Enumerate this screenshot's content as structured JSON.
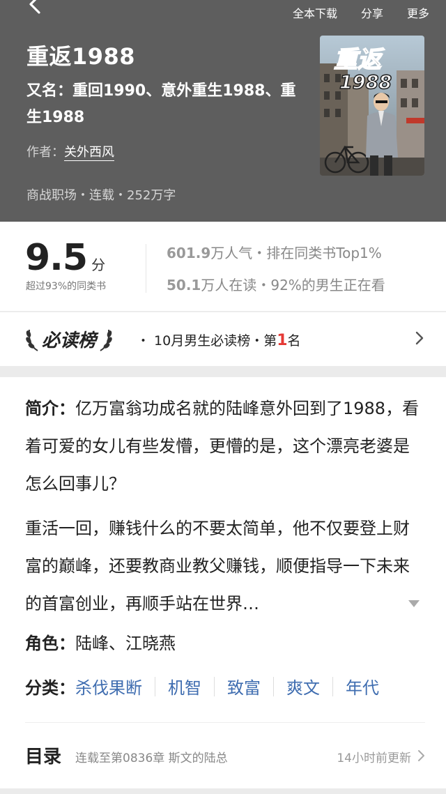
{
  "top_actions": {
    "download": "全本下载",
    "share": "分享",
    "more": "更多"
  },
  "book": {
    "title": "重返1988",
    "alias": "又名：重回1990、意外重生1988、重生1988",
    "author_label": "作者：",
    "author": "关外西风",
    "meta": "商战职场・连载・252万字",
    "cover_title": "重返",
    "cover_year": "1988"
  },
  "stats": {
    "score": "9.5",
    "score_unit": "分",
    "score_sub": "超过93%的同类书",
    "popularity_num": "601.9",
    "popularity_rest": "万人气・排在同类书Top1%",
    "readers_num": "50.1",
    "readers_rest": "万人在读・92%的男生正在看"
  },
  "rank": {
    "badge": "必读榜",
    "text_prefix": "・ 10月男生必读榜・第",
    "rank_num": "1",
    "text_suffix": "名"
  },
  "intro": {
    "label": "简介：",
    "p1": "亿万富翁功成名就的陆峰意外回到了1988，看着可爱的女儿有些发懵，更懵的是，这个漂亮老婆是怎么回事儿？",
    "p2": "重活一回，赚钱什么的不要太简单，他不仅要登上财富的巅峰，还要教商业教父赚钱，顺便指导一下未来的首富创业，再顺手站在世界…"
  },
  "roles": {
    "label": "角色：",
    "value": "陆峰、江晓燕"
  },
  "tags": {
    "label": "分类：",
    "items": [
      "杀伐果断",
      "机智",
      "致富",
      "爽文",
      "年代"
    ]
  },
  "toc": {
    "title": "目录",
    "latest": "连载至第0836章 斯文的陆总",
    "updated": "14小时前更新"
  }
}
